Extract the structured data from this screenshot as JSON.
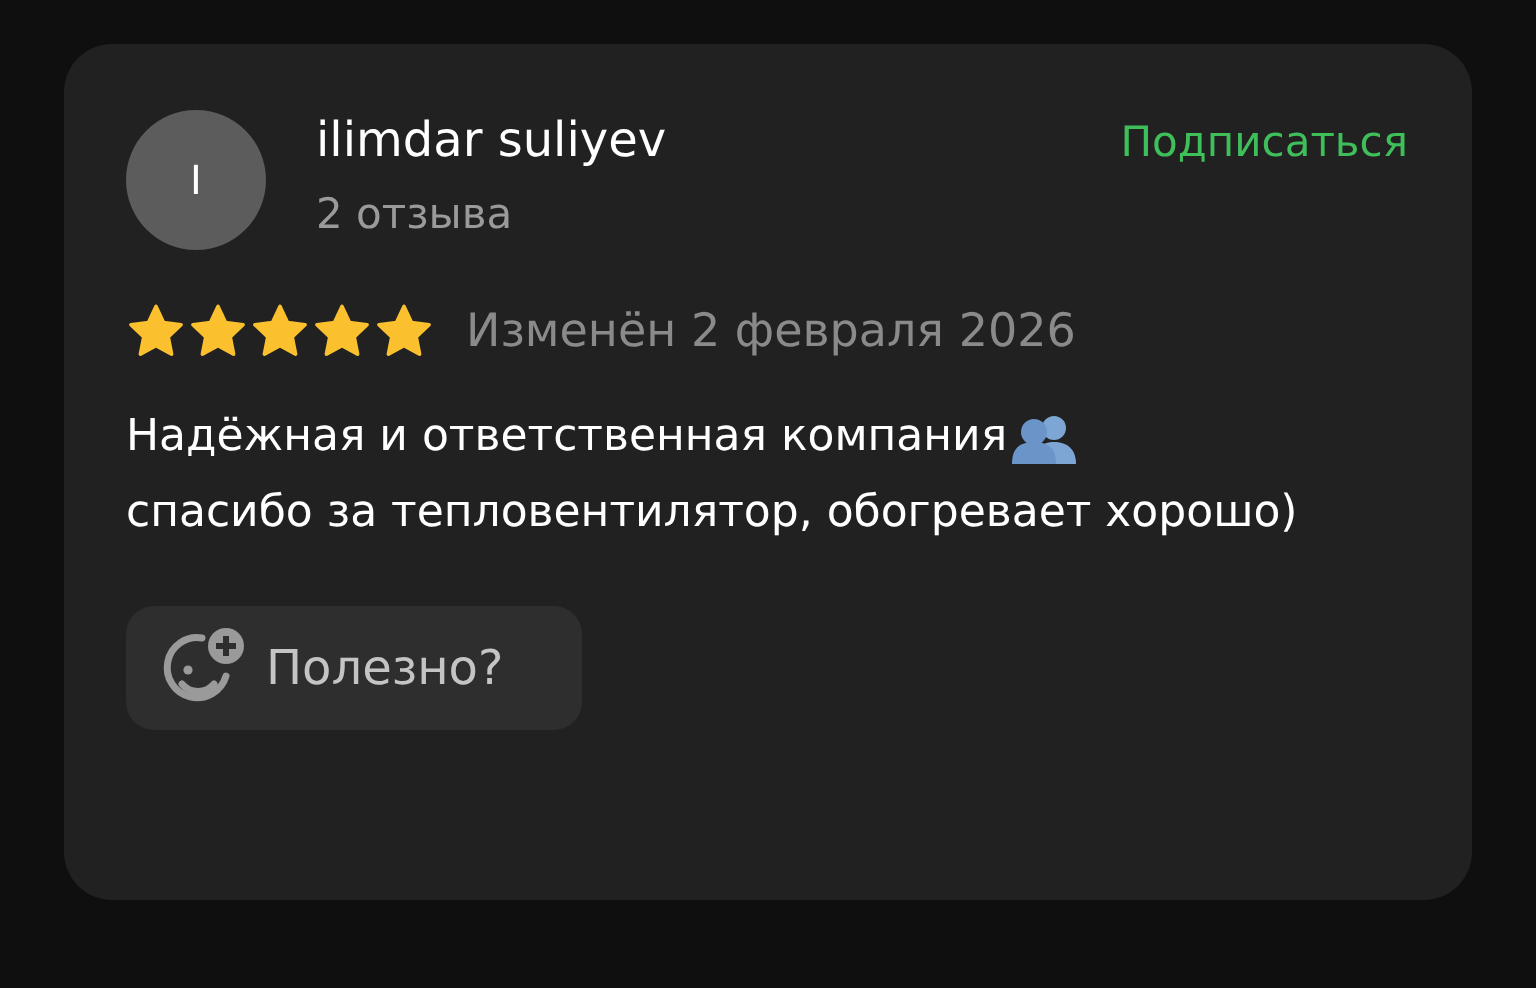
{
  "review": {
    "author": {
      "initial": "I",
      "name": "ilimdar suliyev",
      "reviews_count": "2 отзыва"
    },
    "subscribe_label": "Подписаться",
    "stars": 5,
    "edited": "Изменён 2 февраля 2026",
    "text_lines": [
      "Надёжная и ответственная компания",
      "спасибо за тепловентилятор, обогревает хорошо)"
    ],
    "helpful_label": "Полезно?"
  }
}
